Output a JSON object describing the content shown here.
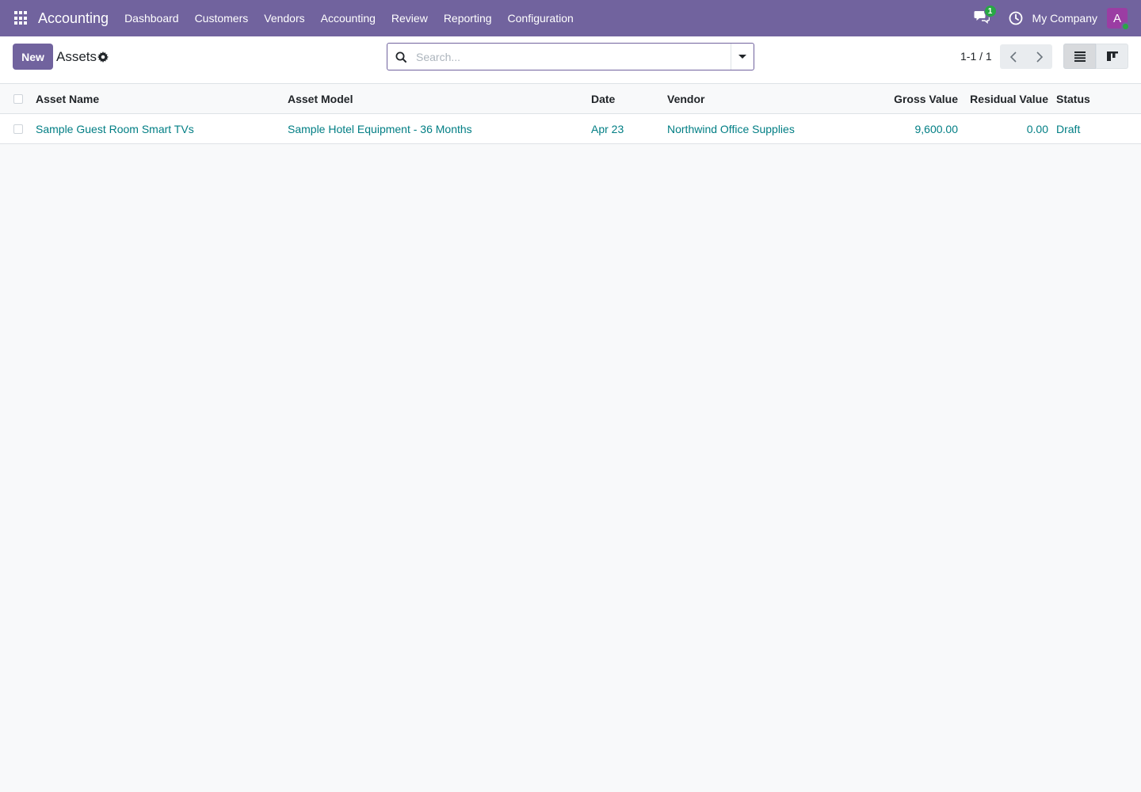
{
  "navbar": {
    "app_name": "Accounting",
    "menu": [
      {
        "label": "Dashboard"
      },
      {
        "label": "Customers"
      },
      {
        "label": "Vendors"
      },
      {
        "label": "Accounting"
      },
      {
        "label": "Review"
      },
      {
        "label": "Reporting"
      },
      {
        "label": "Configuration"
      }
    ],
    "chat_badge_count": "1",
    "company": "My Company",
    "avatar_letter": "A",
    "icons": [
      "apps-grid-icon",
      "chat-icon",
      "clock-icon"
    ]
  },
  "control_panel": {
    "new_label": "New",
    "title": "Assets",
    "search": {
      "placeholder": "Search...",
      "value": ""
    },
    "pager": "1-1 / 1",
    "icons": [
      "gear-icon",
      "search-icon",
      "chevron-left-icon",
      "chevron-right-icon",
      "list-view-icon",
      "kanban-view-icon"
    ]
  },
  "table": {
    "columns": [
      "Asset Name",
      "Asset Model",
      "Date",
      "Vendor",
      "Gross Value",
      "Residual Value",
      "Status"
    ],
    "rows": [
      {
        "asset_name": "Sample Guest Room Smart TVs",
        "asset_model": "Sample Hotel Equipment - 36 Months",
        "date": "Apr 23",
        "vendor": "Northwind Office Supplies",
        "gross_value": "9,600.00",
        "residual_value": "0.00",
        "status": "Draft"
      }
    ]
  },
  "colors": {
    "navbar": "#71639e",
    "link": "#017e84",
    "badge": "#28a745",
    "avatar": "#9b3da3"
  }
}
